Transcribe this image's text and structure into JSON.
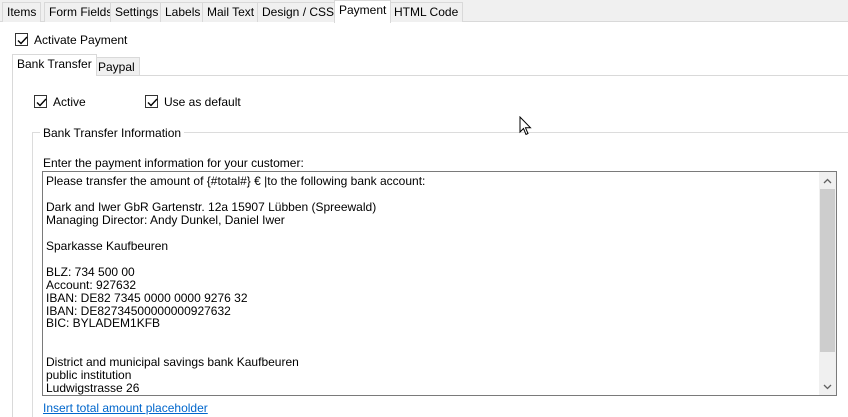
{
  "tabs": [
    "Items",
    "Form Fields",
    "Settings",
    "Labels",
    "Mail Text",
    "Design / CSS",
    "Payment",
    "HTML Code"
  ],
  "active_tab": "Payment",
  "activate_payment": {
    "label": "Activate Payment",
    "checked": true
  },
  "payment_tabs": [
    "Bank Transfer",
    "Paypal"
  ],
  "active_payment_tab": "Bank Transfer",
  "active_checkbox": {
    "label": "Active",
    "checked": true
  },
  "default_checkbox": {
    "label": "Use as default",
    "checked": true
  },
  "group": {
    "title": "Bank Transfer Information",
    "prompt": "Enter the payment information for your customer:",
    "text": "Please transfer the amount of {#total#} € |to the following bank account:\n\nDark and Iwer GbR Gartenstr. 12a 15907 Lübben (Spreewald)\nManaging Director: Andy Dunkel, Daniel Iwer\n\nSparkasse Kaufbeuren\n\nBLZ: 734 500 00\nAccount: 927632\nIBAN: DE82 7345 0000 0000 9276 32\nIBAN: DE82734500000000927632\nBIC: BYLADEM1KFB\n\n\nDistrict and municipal savings bank Kaufbeuren\npublic institution\nLudwigstrasse 26",
    "link": "Insert total amount placeholder"
  }
}
